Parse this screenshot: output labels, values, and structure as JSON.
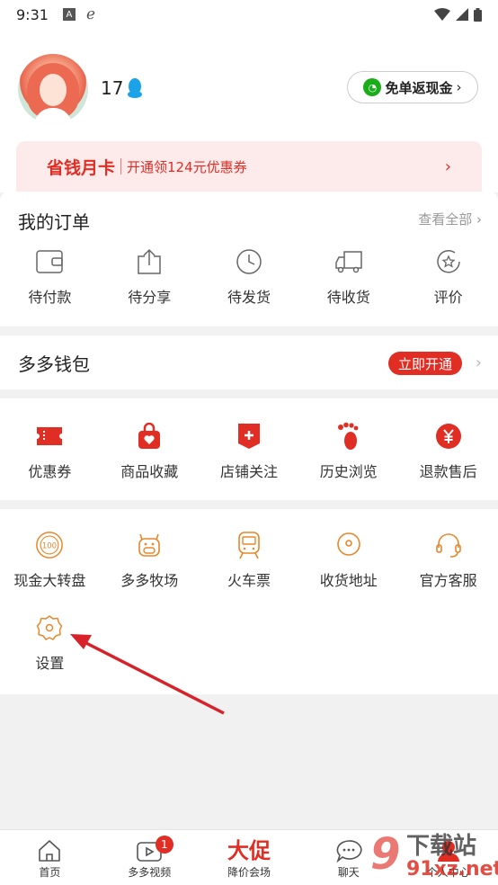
{
  "status": {
    "time": "9:31",
    "icons": [
      "a-icon",
      "e-icon"
    ],
    "right_icons": [
      "wifi-icon",
      "signal-icon",
      "battery-icon"
    ]
  },
  "profile": {
    "name": "17",
    "cashback_label": "免单返现金"
  },
  "month_card": {
    "title": "省钱月卡",
    "subtitle": "开通领124元优惠券"
  },
  "orders": {
    "title": "我的订单",
    "view_all": "查看全部",
    "items": [
      {
        "label": "待付款",
        "icon": "wallet-icon"
      },
      {
        "label": "待分享",
        "icon": "share-icon"
      },
      {
        "label": "待发货",
        "icon": "clock-icon"
      },
      {
        "label": "待收货",
        "icon": "truck-icon"
      },
      {
        "label": "评价",
        "icon": "star-icon"
      }
    ]
  },
  "wallet": {
    "title": "多多钱包",
    "open_label": "立即开通"
  },
  "favs": {
    "items": [
      {
        "label": "优惠券",
        "icon": "coupon-icon"
      },
      {
        "label": "商品收藏",
        "icon": "bag-heart-icon"
      },
      {
        "label": "店铺关注",
        "icon": "store-plus-icon"
      },
      {
        "label": "历史浏览",
        "icon": "footprint-icon"
      },
      {
        "label": "退款售后",
        "icon": "yen-icon"
      }
    ]
  },
  "tools": {
    "items": [
      {
        "label": "现金大转盘",
        "icon": "wheel-icon"
      },
      {
        "label": "多多牧场",
        "icon": "cow-icon"
      },
      {
        "label": "火车票",
        "icon": "train-icon"
      },
      {
        "label": "收货地址",
        "icon": "location-icon"
      },
      {
        "label": "官方客服",
        "icon": "headset-icon"
      },
      {
        "label": "设置",
        "icon": "gear-icon"
      }
    ],
    "wheel_text": "100"
  },
  "tabbar": {
    "items": [
      {
        "label": "首页",
        "icon": "home-icon"
      },
      {
        "label": "多多视频",
        "icon": "video-icon",
        "badge": "1"
      },
      {
        "label": "降价会场",
        "promo": "大促"
      },
      {
        "label": "聊天",
        "icon": "chat-icon"
      },
      {
        "label": "个人中心",
        "icon": "person-icon"
      }
    ]
  },
  "watermark": {
    "line1": "下载站",
    "line2": "91xz.net"
  },
  "colors": {
    "accent": "#e02e24",
    "tool_orange": "#e8872a",
    "annotation_arrow": "#d8222a"
  }
}
